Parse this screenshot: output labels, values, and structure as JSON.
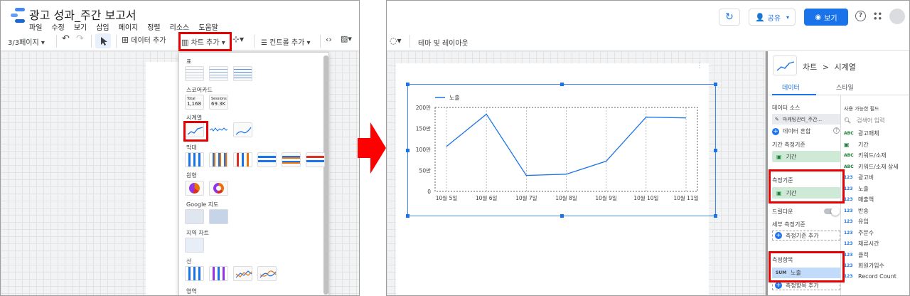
{
  "left": {
    "title": "광고 성과_주간 보고서",
    "menu": [
      "파일",
      "수정",
      "보기",
      "삽입",
      "페이지",
      "정렬",
      "리소스",
      "도움말"
    ],
    "toolbar": {
      "page_indicator": "3/3페이지",
      "add_data": "데이터 추가",
      "add_chart": "차트 추가",
      "add_control": "컨트롤 추가"
    },
    "dropdown": {
      "sections": [
        "표",
        "스코어카드",
        "시계열",
        "막대",
        "원형",
        "Google 지도",
        "지역 차트",
        "선",
        "영역"
      ],
      "scorecards": [
        {
          "label": "Total",
          "value": "1,168"
        },
        {
          "label": "Sessions",
          "value": "69.3K"
        }
      ]
    }
  },
  "right": {
    "header": {
      "share": "공유",
      "view": "보기"
    },
    "toolbar": {
      "theme_layout": "테마 및 레이아웃"
    },
    "panel": {
      "breadcrumb_chart": "차트",
      "breadcrumb_sep": ">",
      "breadcrumb_type": "시계열",
      "tabs": [
        "데이터",
        "스타일"
      ],
      "data_source_label": "데이터 소스",
      "data_source_name": "마케팅관리_주간...",
      "blend": "데이터 혼합",
      "date_dim_label": "기간 측정기준",
      "date_dim_value": "기간",
      "dimension_label": "측정기준",
      "dimension_value": "기간",
      "drilldown": "드릴다운",
      "breakdown_label": "세부 측정기준",
      "add_dimension": "측정기준 추가",
      "metric_label": "측정항목",
      "metric_agg": "SUM",
      "metric_value": "노출",
      "add_metric": "측정항목 추가",
      "available_fields": "사용 가능한 필드",
      "search_placeholder": "검색어 입력",
      "fields": [
        {
          "type": "ABC",
          "name": "광고매체"
        },
        {
          "type": "date",
          "name": "기간"
        },
        {
          "type": "ABC",
          "name": "키워드/소재"
        },
        {
          "type": "ABC",
          "name": "키워드/소재 상세"
        },
        {
          "type": "123",
          "name": "광고비"
        },
        {
          "type": "123",
          "name": "노출"
        },
        {
          "type": "123",
          "name": "매출액"
        },
        {
          "type": "123",
          "name": "반송"
        },
        {
          "type": "123",
          "name": "유입"
        },
        {
          "type": "123",
          "name": "주문수"
        },
        {
          "type": "123",
          "name": "체류시간"
        },
        {
          "type": "123",
          "name": "클릭"
        },
        {
          "type": "123",
          "name": "회원가입수"
        },
        {
          "type": "123",
          "name": "Record Count"
        }
      ]
    }
  },
  "chart_data": {
    "type": "line",
    "legend": "노출",
    "categories": [
      "10월 5일",
      "10월 6일",
      "10월 7일",
      "10월 8일",
      "10월 9일",
      "10월 10일",
      "10월 11일"
    ],
    "series": [
      {
        "name": "노출",
        "values": [
          1070000,
          1840000,
          380000,
          410000,
          720000,
          1770000,
          1750000
        ]
      }
    ],
    "yticks": [
      "0",
      "50만",
      "100만",
      "150만",
      "200만"
    ],
    "ylim": [
      0,
      2000000
    ],
    "line_color": "#1a73e8"
  }
}
